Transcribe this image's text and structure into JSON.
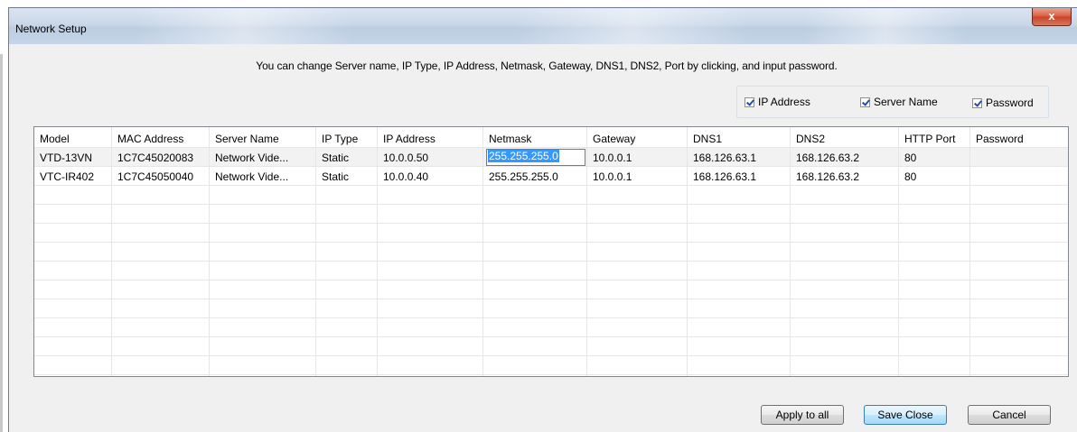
{
  "window": {
    "title": "Network Setup",
    "close_glyph": "x"
  },
  "instruction": "You can change Server name, IP Type, IP Address, Netmask, Gateway, DNS1, DNS2, Port by clicking, and input password.",
  "options": [
    {
      "label": "IP Address",
      "checked": true
    },
    {
      "label": "Server Name",
      "checked": true
    },
    {
      "label": "Password",
      "checked": true
    }
  ],
  "table": {
    "columns": [
      "Model",
      "MAC Address",
      "Server Name",
      "IP Type",
      "IP Address",
      "Netmask",
      "Gateway",
      "DNS1",
      "DNS2",
      "HTTP Port",
      "Password"
    ],
    "rows": [
      [
        "VTD-13VN",
        "1C7C45020083",
        "Network Vide...",
        "Static",
        "10.0.0.50",
        "255.255.255.0",
        "10.0.0.1",
        "168.126.63.1",
        "168.126.63.2",
        "80",
        ""
      ],
      [
        "VTC-IR402",
        "1C7C45050040",
        "Network Vide...",
        "Static",
        "10.0.0.40",
        "255.255.255.0",
        "10.0.0.1",
        "168.126.63.1",
        "168.126.63.2",
        "80",
        ""
      ]
    ],
    "editing": {
      "row": 0,
      "column": "Netmask",
      "value": "255.255.255.0",
      "selected": true
    }
  },
  "buttons": {
    "apply_all": "Apply to all",
    "save_close": "Save  Close",
    "cancel": "Cancel"
  },
  "colors": {
    "accent_selection": "#3399ff",
    "default_button_border": "#3c7fb1",
    "close_button": "#c7432a"
  }
}
